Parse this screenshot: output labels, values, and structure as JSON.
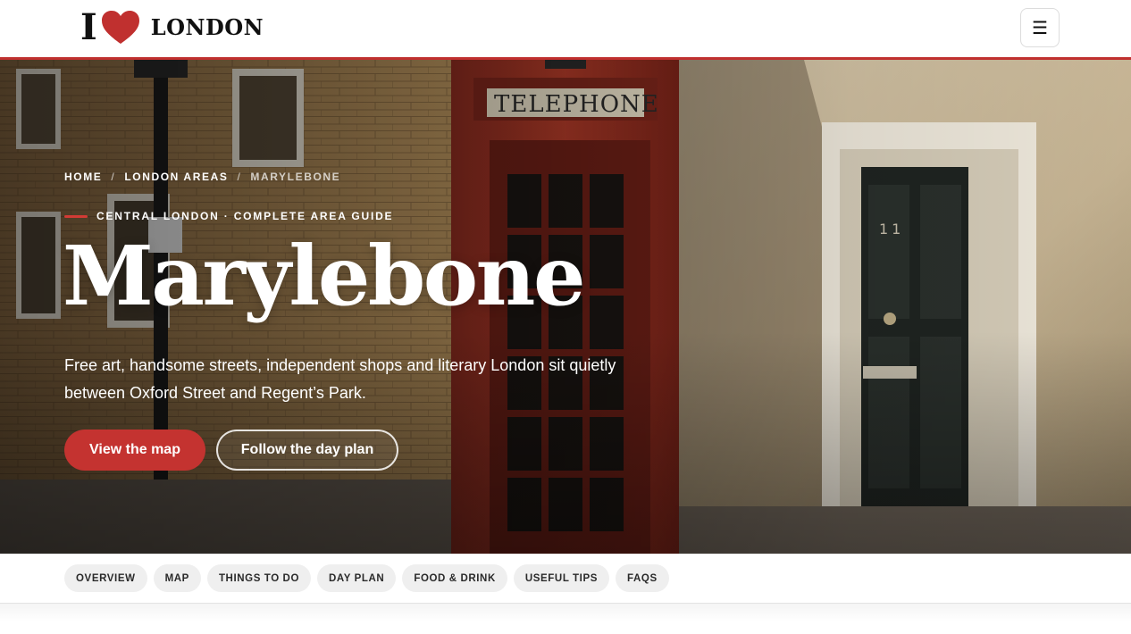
{
  "header": {
    "logo_prefix": "I",
    "logo_word": "LONDON",
    "menu_icon": "☰",
    "brand_color": "#c0302f"
  },
  "hero": {
    "breadcrumb": [
      "HOME",
      "LONDON AREAS",
      "MARYLEBONE"
    ],
    "breadcrumb_separator": "/",
    "eyebrow": "CENTRAL LONDON · COMPLETE AREA GUIDE",
    "title": "Marylebone",
    "lead": "Free art, handsome streets, independent shops and literary London sit quietly between Oxford Street and Regent’s Park.",
    "primary_button": "View the map",
    "secondary_button": "Follow the day plan",
    "accent_color": "#c43330"
  },
  "tabs": [
    "OVERVIEW",
    "MAP",
    "THINGS TO DO",
    "DAY PLAN",
    "FOOD & DRINK",
    "USEFUL TIPS",
    "FAQS"
  ]
}
